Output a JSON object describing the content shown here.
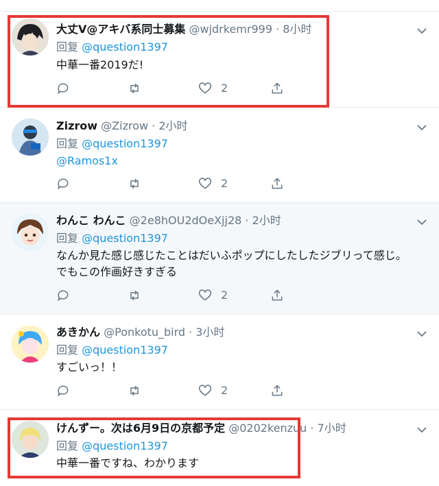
{
  "tweets": [
    {
      "name": "大丈V@アキバ系同士募集",
      "handle": "@wjdrkemr999",
      "dot": "·",
      "time": "8小时",
      "reply_prefix": "回复",
      "reply_to": "@question1397",
      "body": "中華一番2019だ!",
      "like_count": "2"
    },
    {
      "name": "Zizrow",
      "handle": "@Zizrow",
      "dot": "·",
      "time": "2小时",
      "reply_prefix": "回复",
      "reply_to": "@question1397",
      "body_mention": "@Ramos1x",
      "like_count": "2"
    },
    {
      "name": "わんこ わんこ",
      "handle": "@2e8hOU2dOeXjj28",
      "dot": "·",
      "time": "2小时",
      "reply_prefix": "回复",
      "reply_to": "@question1397",
      "body_line1": "なんか見た感じ感じたことはだいふポップにしたしたジブリって感じ。",
      "body_line2": "でもこの作画好きすぎる",
      "like_count": "2"
    },
    {
      "name": "あきかん",
      "handle": "@Ponkotu_bird",
      "dot": "·",
      "time": "3小时",
      "reply_prefix": "回复",
      "reply_to": "@question1397",
      "body": "すごいっ！！",
      "like_count": "2"
    },
    {
      "name": "けんずー。次は6月9日の京都予定",
      "handle": "@0202kenzuu",
      "dot": "·",
      "time": "7小时",
      "reply_prefix": "回复",
      "reply_to": "@question1397",
      "body": "中華一番ですね、わかります"
    }
  ],
  "colors": {
    "link": "#1b95e0",
    "muted": "#657786",
    "highlight_bg": "#f5f8fa",
    "annotation_box": "#e53935"
  },
  "icons": [
    "reply-icon",
    "retweet-icon",
    "like-icon",
    "share-icon",
    "chevron-down-icon"
  ]
}
